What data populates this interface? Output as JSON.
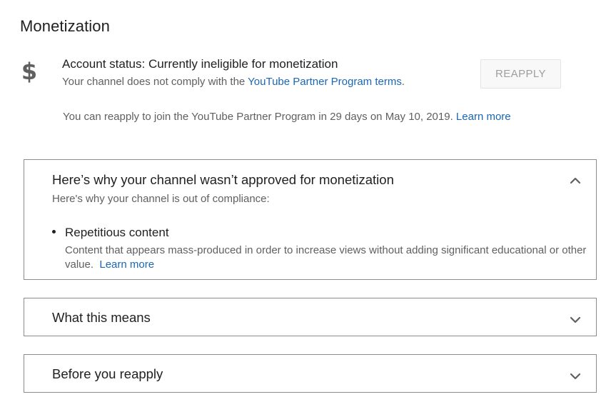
{
  "page": {
    "title": "Monetization"
  },
  "status": {
    "icon": "dollar-icon",
    "title": "Account status: Currently ineligible for monetization",
    "sub_prefix": "Your channel does not comply with the ",
    "sub_link": "YouTube Partner Program terms",
    "sub_suffix": ".",
    "reapply_label": "REAPPLY",
    "reapply_note_prefix": "You can reapply to join the YouTube Partner Program in 29 days on May 10, 2019. ",
    "reapply_note_link": "Learn more"
  },
  "panels": [
    {
      "title": "Here’s why your channel wasn’t approved for monetization",
      "expanded": true,
      "description": "Here's why your channel is out of compliance:",
      "reasons": [
        {
          "title": "Repetitious content",
          "description": "Content that appears mass-produced in order to increase views without adding significant educational or other value.",
          "link": "Learn more"
        }
      ]
    },
    {
      "title": "What this means",
      "expanded": false
    },
    {
      "title": "Before you reapply",
      "expanded": false
    }
  ],
  "colors": {
    "link": "#1a67b6",
    "text_primary": "#212121",
    "text_secondary": "#606060",
    "border": "#8c8c8c",
    "disabled_button_text": "#9e9e9e"
  }
}
